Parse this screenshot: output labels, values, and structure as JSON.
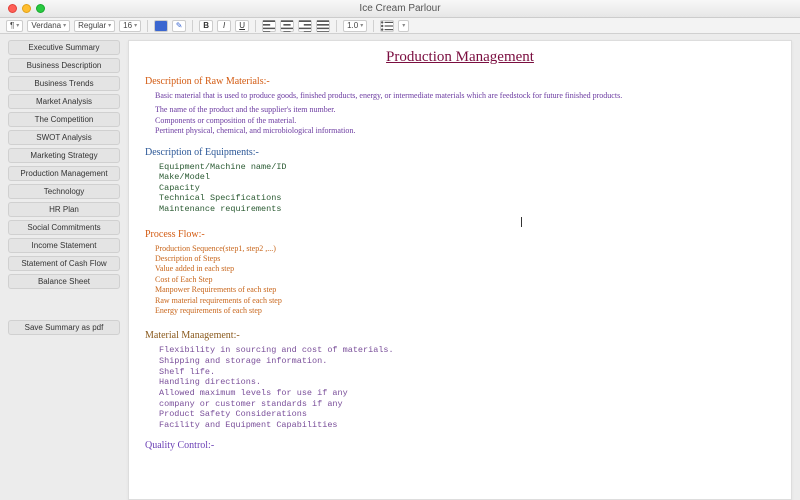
{
  "window": {
    "title": "Ice Cream Parlour"
  },
  "toolbar": {
    "font_family": "Verdana",
    "font_weight": "Regular",
    "font_size": "16",
    "text_color": "#3a66d0",
    "highlight_color": "#ffffff",
    "bold": "B",
    "italic": "I",
    "underline": "U",
    "line_spacing": "1.0"
  },
  "sidebar": {
    "items": [
      "Executive Summary",
      "Business Description",
      "Business Trends",
      "Market Analysis",
      "The Competition",
      "SWOT Analysis",
      "Marketing Strategy",
      "Production Management",
      "Technology",
      "HR Plan",
      "Social Commitments",
      "Income Statement",
      "Statement of Cash Flow",
      "Balance Sheet"
    ],
    "save_label": "Save Summary as pdf"
  },
  "doc": {
    "title": "Production Management",
    "raw_h": "Description of Raw Materials:-",
    "raw_p1": "Basic material that is used to produce goods, finished products, energy, or intermediate materials which are feedstock for future finished products.",
    "raw_l1": "The name of the product and the supplier's item number.",
    "raw_l2": "Components or composition of the material.",
    "raw_l3": "Pertinent physical, chemical, and microbiological information.",
    "equip_h": "Description of Equipments:-",
    "equip_block": "Equipment/Machine name/ID\nMake/Model\nCapacity\nTechnical Specifications\nMaintenance requirements",
    "flow_h": "Process Flow:-",
    "flow_l1": "Production Sequence(step1, step2 ,...)",
    "flow_l2": "Description of Steps",
    "flow_l3": "Value added in each step",
    "flow_l4": "Cost of Each Step",
    "flow_l5": "Manpower Requirements of each step",
    "flow_l6": "Raw material requirements of each step",
    "flow_l7": "Energy requirements of each step",
    "mat_h": "Material Management:-",
    "mat_block": "Flexibility in sourcing and cost of materials.\nShipping and storage information.\nShelf life.\nHandling directions.\nAllowed maximum levels for use if any\ncompany or customer standards if any\nProduct Safety Considerations\nFacility and Equipment Capabilities",
    "qc_h": "Quality Control:-"
  }
}
